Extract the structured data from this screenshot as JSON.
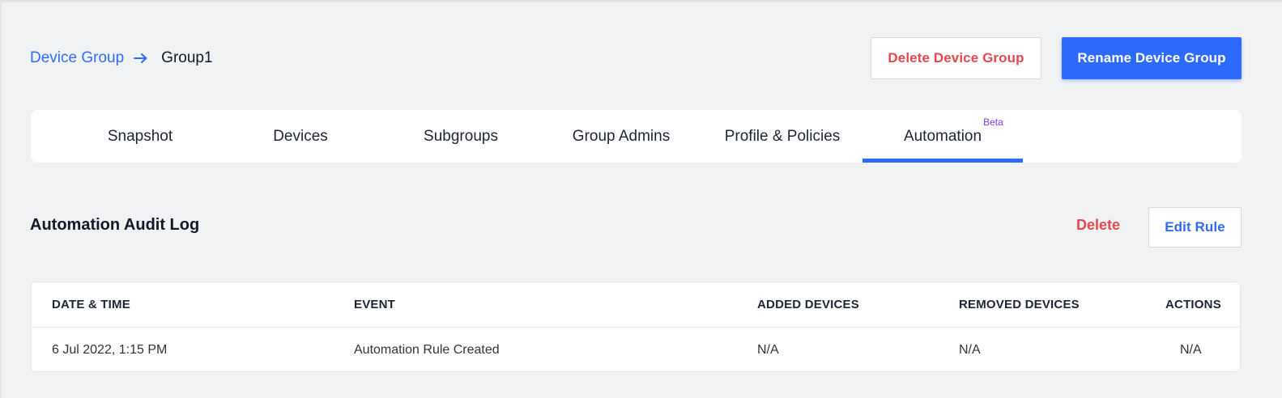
{
  "breadcrumb": {
    "parent": "Device Group",
    "current": "Group1"
  },
  "header_buttons": {
    "delete_group": "Delete Device Group",
    "rename_group": "Rename Device Group"
  },
  "tabs": [
    {
      "label": "Snapshot"
    },
    {
      "label": "Devices"
    },
    {
      "label": "Subgroups"
    },
    {
      "label": "Group Admins"
    },
    {
      "label": "Profile & Policies"
    },
    {
      "label": "Automation",
      "badge": "Beta",
      "active": true
    }
  ],
  "section": {
    "title": "Automation Audit Log",
    "delete_label": "Delete",
    "edit_rule_label": "Edit Rule"
  },
  "table": {
    "columns": [
      "DATE & TIME",
      "EVENT",
      "ADDED DEVICES",
      "REMOVED DEVICES",
      "ACTIONS"
    ],
    "rows": [
      {
        "date_time": "6 Jul 2022, 1:15 PM",
        "event": "Automation Rule Created",
        "added": "N/A",
        "removed": "N/A",
        "actions": "N/A"
      }
    ]
  },
  "colors": {
    "primary": "#2d6bff",
    "danger": "#e5484d",
    "badge": "#7c3aed",
    "background": "#f1f2f4"
  },
  "icons": {
    "breadcrumb_separator": "arrow-right-icon"
  }
}
